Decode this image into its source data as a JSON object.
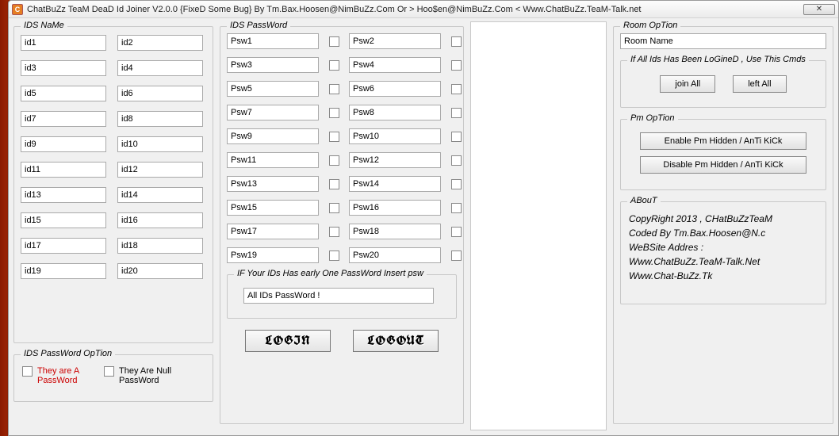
{
  "window": {
    "title": "ChatBuZz TeaM DeaD Id Joiner V2.0.0 {FixeD Some Bug} By Tm.Bax.Hoosen@NimBuZz.Com Or > Hoo$en@NimBuZz.Com < Www.ChatBuZz.TeaM-Talk.net",
    "icon_letter": "C",
    "close_glyph": "✕"
  },
  "ids_name": {
    "legend": "IDS NaMe",
    "fields": [
      "id1",
      "id2",
      "id3",
      "id4",
      "id5",
      "id6",
      "id7",
      "id8",
      "id9",
      "id10",
      "id11",
      "id12",
      "id13",
      "id14",
      "id15",
      "id16",
      "id17",
      "id18",
      "id19",
      "id20"
    ]
  },
  "pw_option": {
    "legend": "IDS PassWord OpTion",
    "opt1": "They are A PassWord",
    "opt2": "They Are Null PassWord"
  },
  "ids_pass": {
    "legend": "IDS PassWord",
    "fields": [
      "Psw1",
      "Psw2",
      "Psw3",
      "Psw4",
      "Psw5",
      "Psw6",
      "Psw7",
      "Psw8",
      "Psw9",
      "Psw10",
      "Psw11",
      "Psw12",
      "Psw13",
      "Psw14",
      "Psw15",
      "Psw16",
      "Psw17",
      "Psw18",
      "Psw19",
      "Psw20"
    ]
  },
  "early_pw": {
    "legend": "IF Your IDs Has early One PassWord Insert psw",
    "value": "All IDs PassWord !"
  },
  "buttons": {
    "login": "LOGIN",
    "logout": "LOGOUT"
  },
  "room": {
    "legend": "Room OpTion",
    "room_name": "Room Name",
    "cmds_legend": "If All Ids Has Been LoGineD , Use This Cmds",
    "join_all": "join All",
    "left_all": "left All",
    "pm_legend": "Pm OpTion",
    "pm_enable": "Enable Pm Hidden / AnTi KiCk",
    "pm_disable": "Disable Pm Hidden / AnTi KiCk",
    "about_legend": "ABouT",
    "about_lines": [
      "CopyRight 2013 , CHatBuZzTeaM",
      "Coded By Tm.Bax.Hoosen@N.c",
      "WeBSite Addres :",
      "Www.ChatBuZz.TeaM-Talk.Net",
      "Www.Chat-BuZz.Tk"
    ]
  }
}
